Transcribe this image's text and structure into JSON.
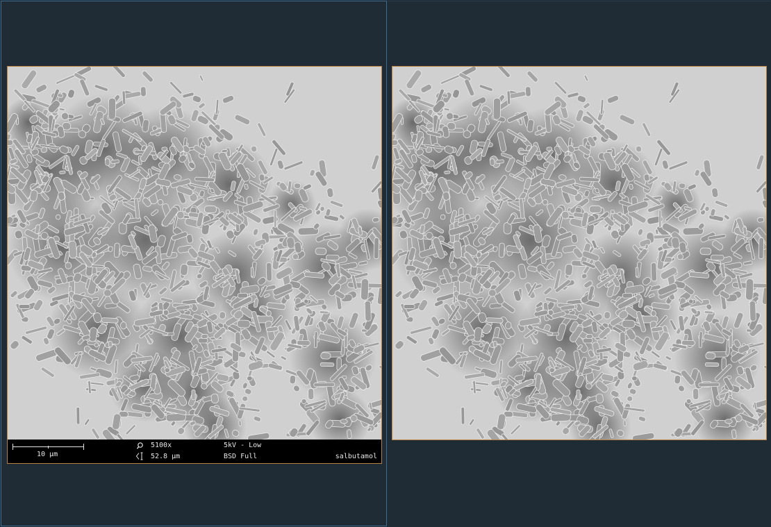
{
  "viewer": {
    "panes": [
      {
        "label": "sem-image-left"
      },
      {
        "label": "sem-image-right"
      }
    ]
  },
  "databar": {
    "scale_label": "10 µm",
    "magnification": "5100x",
    "field_of_view": "52.8 µm",
    "voltage": "5kV - Low",
    "detector": "BSD Full",
    "sample_name": "salbutamol"
  },
  "icons": {
    "magnification": "zoom-icon",
    "field_of_view": "field-width-icon"
  },
  "colors": {
    "background": "#1f2c36",
    "active_pane_border": "#3d6b8f",
    "image_border": "#b8803e",
    "databar_bg": "#000000",
    "databar_text": "#e6e6e6"
  }
}
